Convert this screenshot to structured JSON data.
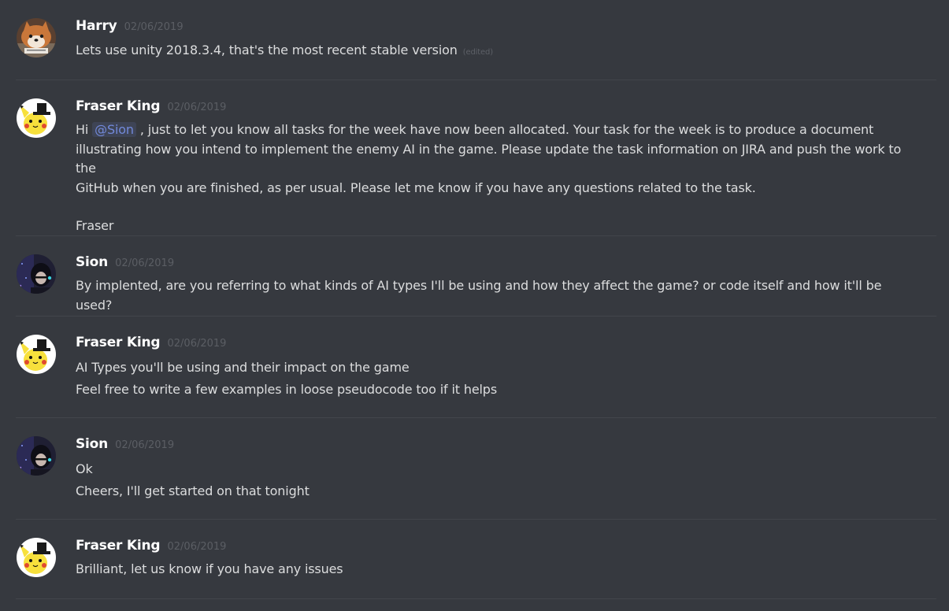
{
  "messages": [
    {
      "author": "Harry",
      "timestamp": "02/06/2019",
      "avatar": "shiba-dog-avatar",
      "lines": [
        "Lets use unity 2018.3.4, that's the most recent stable version"
      ],
      "edited_label": "(edited)"
    },
    {
      "author": "Fraser King",
      "timestamp": "02/06/2019",
      "avatar": "pikachu-tophat-avatar",
      "greeting": "Hi",
      "mention": "@Sion",
      "line1_rest": ", just to let you know all tasks for the week have now been allocated. Your task for the week is to produce a document",
      "line2": "illustrating how you intend to implement the enemy AI in the game. Please update the task information on JIRA and push the work to the",
      "line3": "GitHub when you are finished, as per usual. Please let me know if you have any questions related to the task.",
      "signoff": "Fraser"
    },
    {
      "author": "Sion",
      "timestamp": "02/06/2019",
      "avatar": "dark-anime-avatar",
      "lines": [
        "By implented, are you referring to what kinds of AI types I'll be using and how they affect the game? or code itself and how it'll be used?"
      ]
    },
    {
      "author": "Fraser King",
      "timestamp": "02/06/2019",
      "avatar": "pikachu-tophat-avatar",
      "lines": [
        "AI Types you'll be using and their impact on the game",
        "Feel free to write a few examples in loose pseudocode too if it helps"
      ]
    },
    {
      "author": "Sion",
      "timestamp": "02/06/2019",
      "avatar": "dark-anime-avatar",
      "lines": [
        "Ok",
        "Cheers, I'll get started on that tonight"
      ]
    },
    {
      "author": "Fraser King",
      "timestamp": "02/06/2019",
      "avatar": "pikachu-tophat-avatar",
      "lines": [
        "Brilliant, let us know if you have any issues"
      ]
    }
  ],
  "colors": {
    "background": "#36393f",
    "username": "#ffffff",
    "text": "#dcddde",
    "timestamp": "#5b5e64",
    "mention": "#7289da",
    "divider": "#42454b"
  }
}
